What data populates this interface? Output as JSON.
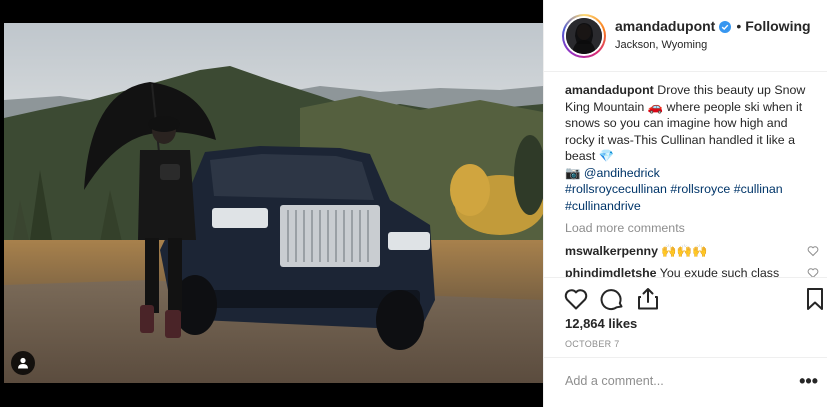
{
  "post": {
    "image_alt": "Woman with a black umbrella standing beside a dark blue Rolls-Royce Cullinan on a mountain meadow",
    "tag_icon": "user-tag-icon"
  },
  "header": {
    "username": "amandadupont",
    "verified_icon": "verified-badge-icon",
    "dot": "•",
    "follow_label": "Following",
    "location": "Jackson, Wyoming"
  },
  "caption": {
    "username": "amandadupont",
    "text": " Drove this beauty up Snow King Mountain 🚗 where people ski when it snows so you can imagine how high and rocky it was-This Cullinan handled it like a beast 💎",
    "camera": "📷 ",
    "mention": "@andihedrick",
    "hashtags": [
      "#rollsroycecullinan",
      "#rollsroyce",
      "#cullinan",
      "#cullinandrive"
    ]
  },
  "load_more": "Load more comments",
  "comments": [
    {
      "username": "mswalkerpenny",
      "text": " 🙌🙌🙌"
    },
    {
      "username": "phindimdletshe",
      "text": " You exude such class"
    }
  ],
  "actions": {
    "like_icon": "heart-icon",
    "comment_icon": "comment-icon",
    "share_icon": "share-icon",
    "save_icon": "bookmark-icon"
  },
  "likes": "12,864 likes",
  "date": "OCTOBER 7",
  "add_comment": {
    "placeholder": "Add a comment...",
    "more_label": "•••"
  },
  "colors": {
    "link": "#003569",
    "verified": "#3897f0",
    "muted": "#8e8e8e",
    "border": "#efefef"
  }
}
